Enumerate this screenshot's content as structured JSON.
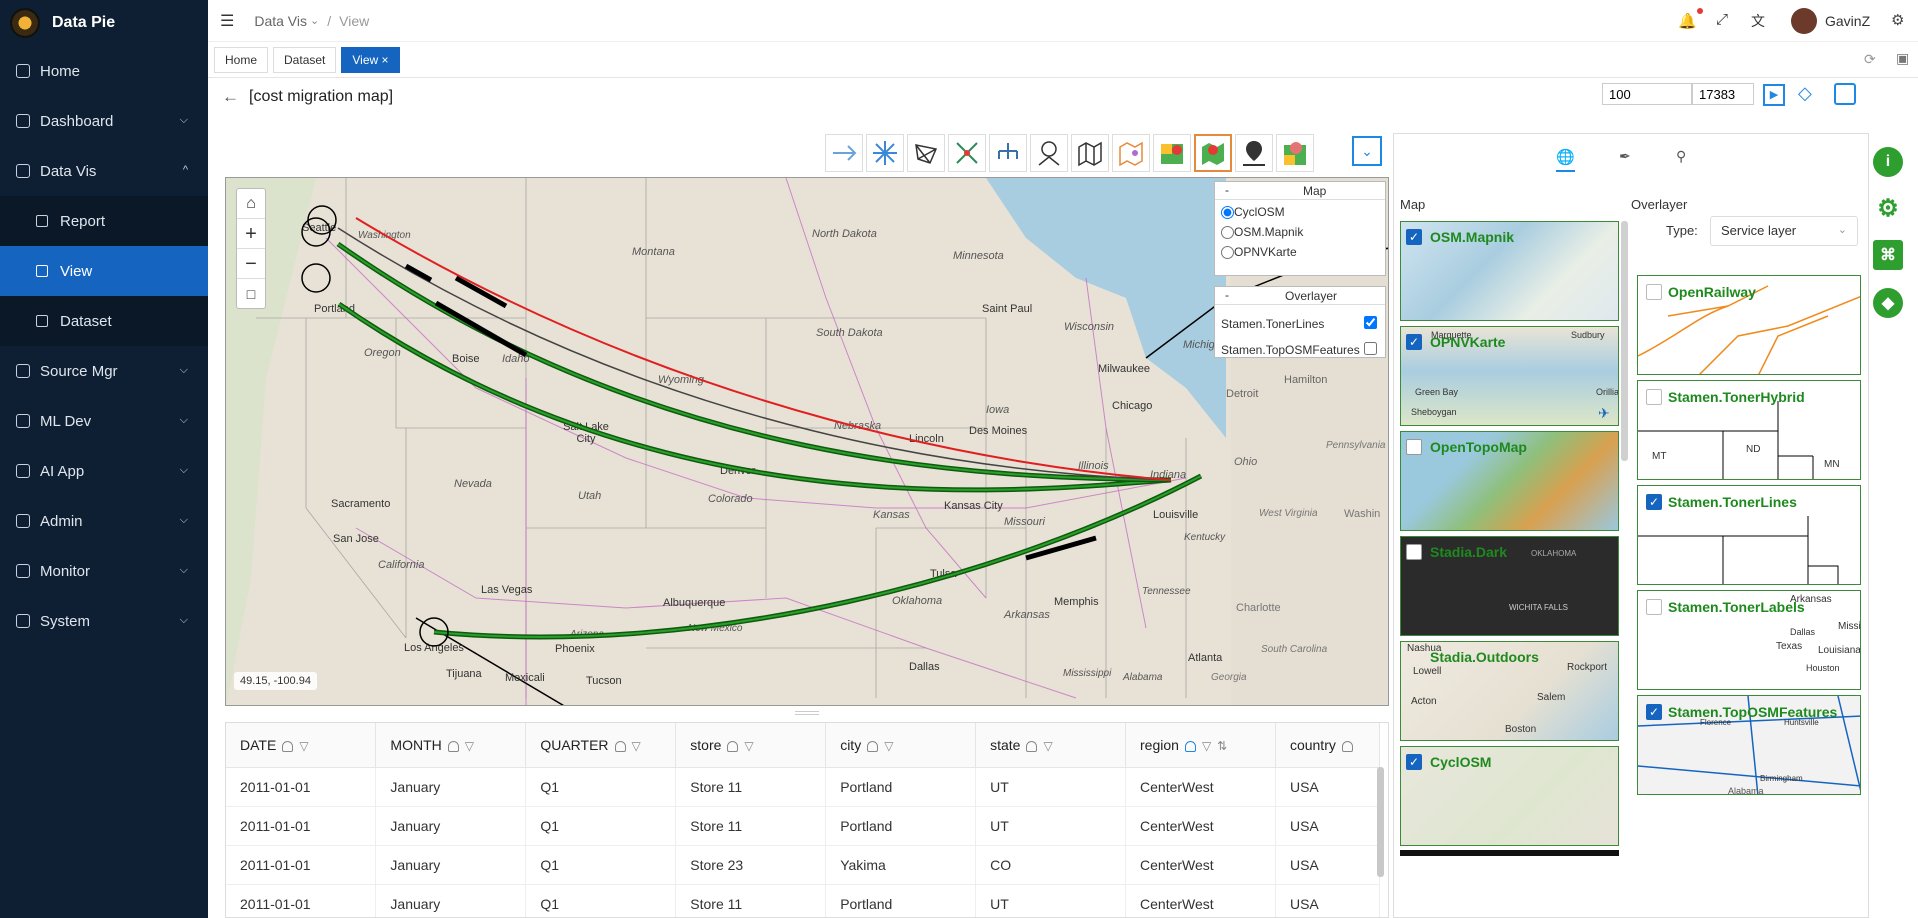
{
  "app": {
    "name": "Data Pie"
  },
  "sidebar": {
    "items": [
      {
        "label": "Home",
        "icon": "home-icon"
      },
      {
        "label": "Dashboard",
        "icon": "dashboard-icon"
      },
      {
        "label": "Data Vis",
        "icon": "data-vis-icon"
      },
      {
        "label": "Report",
        "icon": "report-icon"
      },
      {
        "label": "View",
        "icon": "view-icon"
      },
      {
        "label": "Dataset",
        "icon": "dataset-icon"
      },
      {
        "label": "Source Mgr",
        "icon": "source-icon"
      },
      {
        "label": "ML Dev",
        "icon": "ml-icon"
      },
      {
        "label": "AI App",
        "icon": "ai-icon"
      },
      {
        "label": "Admin",
        "icon": "admin-icon"
      },
      {
        "label": "Monitor",
        "icon": "monitor-icon"
      },
      {
        "label": "System",
        "icon": "system-icon"
      }
    ],
    "active": "View"
  },
  "topbar": {
    "crumb1": "Data Vis",
    "crumb2": "View",
    "user": "GavinZ"
  },
  "tabs": {
    "t1": "Home",
    "t2": "Dataset",
    "t3": "View ×"
  },
  "title": {
    "text": "[cost migration map]",
    "input1": "100",
    "input2": "17383"
  },
  "map": {
    "coords": "49.15, -100.94",
    "layer_panel": {
      "title": "Map",
      "options": [
        "CyclOSM",
        "OSM.Mapnik",
        "OPNVKarte"
      ],
      "selected": "CyclOSM",
      "overlayer_title": "Overlayer",
      "overlays": [
        {
          "name": "Stamen.TonerLines",
          "checked": true
        },
        {
          "name": "Stamen.TopOSMFeatures",
          "checked": false
        }
      ]
    },
    "labels": {
      "seattle": "Seattle",
      "washington": "Washington",
      "montana": "Montana",
      "north_dakota": "North Dakota",
      "minnesota": "Minnesota",
      "portland": "Portland",
      "oregon": "Oregon",
      "idaho": "Idaho",
      "boise": "Boise",
      "wyoming": "Wyoming",
      "south_dakota": "South Dakota",
      "saint_paul": "Saint Paul",
      "wisconsin": "Wisconsin",
      "milwaukee": "Milwaukee",
      "michigan": "Michig",
      "detroit": "Detroit",
      "hamilton": "Hamilton",
      "salt_lake": "Salt Lake City",
      "nebraska": "Nebraska",
      "iowa": "Iowa",
      "des_moines": "Des Moines",
      "chicago": "Chicago",
      "lincoln": "Lincoln",
      "nevada": "Nevada",
      "utah": "Utah",
      "denver": "Denver",
      "colorado": "Colorado",
      "illinois": "Illinois",
      "indiana": "Indiana",
      "ohio": "Ohio",
      "sacramento": "Sacramento",
      "kansas": "Kansas",
      "kansas_city": "Kansas City",
      "missouri": "Missouri",
      "louisville": "Louisville",
      "kentucky": "Kentucky",
      "west_virginia": "West Virginia",
      "washington2": "Washin",
      "pennsylvania": "Pennsylvania",
      "san_jose": "San Jose",
      "california": "California",
      "las_vegas": "Las Vegas",
      "tulsa": "Tulsa",
      "oklahoma": "Oklahoma",
      "tennessee": "Tennessee",
      "charlotte": "Charlotte",
      "albuquerque": "Albuquerque",
      "arizona": "Arizona",
      "new_mexico": "New Mexico",
      "arkansas": "Arkansas",
      "memphis": "Memphis",
      "south_carolina": "South Carolina",
      "los_angeles": "Los Angeles",
      "phoenix": "Phoenix",
      "tijuana": "Tijuana",
      "mexicali": "Mexicali",
      "tucson": "Tucson",
      "dallas": "Dallas",
      "mississippi": "Mississippi",
      "alabama": "Alabama",
      "atlanta": "Atlanta",
      "georgia": "Georgia"
    }
  },
  "table": {
    "columns": [
      "DATE",
      "MONTH",
      "QUARTER",
      "store",
      "city",
      "state",
      "region",
      "country"
    ],
    "rows": [
      [
        "2011-01-01",
        "January",
        "Q1",
        "Store 11",
        "Portland",
        "UT",
        "CenterWest",
        "USA"
      ],
      [
        "2011-01-01",
        "January",
        "Q1",
        "Store 11",
        "Portland",
        "UT",
        "CenterWest",
        "USA"
      ],
      [
        "2011-01-01",
        "January",
        "Q1",
        "Store 23",
        "Yakima",
        "CO",
        "CenterWest",
        "USA"
      ],
      [
        "2011-01-01",
        "January",
        "Q1",
        "Store 11",
        "Portland",
        "UT",
        "CenterWest",
        "USA"
      ]
    ]
  },
  "rightpanel": {
    "map_heading": "Map",
    "overlayer_heading": "Overlayer",
    "type_label": "Type:",
    "type_value": "Service layer",
    "maps": [
      {
        "name": "OSM.Mapnik",
        "checked": true
      },
      {
        "name": "OPNVKarte",
        "checked": true
      },
      {
        "name": "OpenTopoMap",
        "checked": false
      },
      {
        "name": "Stadia.Dark",
        "checked": false
      },
      {
        "name": "Stadia.Outdoors",
        "checked": false
      },
      {
        "name": "CyclOSM",
        "checked": true
      }
    ],
    "overlays": [
      {
        "name": "OpenRailway",
        "checked": false
      },
      {
        "name": "Stamen.TonerHybrid",
        "checked": false
      },
      {
        "name": "Stamen.TonerLines",
        "checked": true
      },
      {
        "name": "Stamen.TonerLabels",
        "checked": false
      },
      {
        "name": "Stamen.TopOSMFeatures",
        "checked": true
      }
    ],
    "thumb_text": {
      "marquette": "Marquette",
      "sudbury": "Sudbury",
      "green_bay": "Green Bay",
      "sheboygan": "Sheboygan",
      "orillia": "Orillia",
      "oklahoma": "OKLAHOMA",
      "wichita": "WICHITA FALLS",
      "nashua": "Nashua",
      "lowell": "Lowell",
      "rockport": "Rockport",
      "acton": "Acton",
      "salem": "Salem",
      "boston": "Boston",
      "mt": "MT",
      "nd": "ND",
      "mn": "MN",
      "arkansas": "Arkansas",
      "dallas": "Dallas",
      "texas": "Texas",
      "louisiana": "Louisiana",
      "houston": "Houston",
      "missi": "Missi",
      "florence": "Florence",
      "huntsville": "Huntsville",
      "birmingham": "Birmingham",
      "alabama": "Alabama"
    }
  },
  "colors": {
    "sidebar_bg": "#0e1f33",
    "active": "#1565c0",
    "route_green": "#1d7a1d",
    "route_red": "#e02020",
    "label_green": "#1e8a1e"
  }
}
